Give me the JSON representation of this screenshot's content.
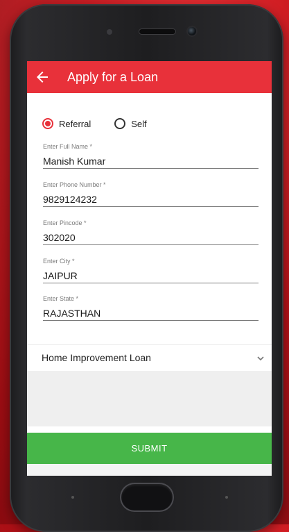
{
  "app_bar": {
    "title": "Apply for a Loan"
  },
  "applicant_type": {
    "options": [
      {
        "label": "Referral",
        "selected": true
      },
      {
        "label": "Self",
        "selected": false
      }
    ]
  },
  "fields": [
    {
      "label": "Enter Full Name *",
      "value": "Manish Kumar"
    },
    {
      "label": "Enter Phone Number *",
      "value": "9829124232"
    },
    {
      "label": "Enter Pincode *",
      "value": "302020"
    },
    {
      "label": "Enter City *",
      "value": "JAIPUR"
    },
    {
      "label": "Enter State *",
      "value": "RAJASTHAN"
    }
  ],
  "loan_type": {
    "selected": "Home Improvement Loan"
  },
  "submit_label": "SUBMIT",
  "colors": {
    "accent": "#e8313a",
    "submit": "#47b649",
    "background": "#c8141b"
  },
  "icons": {
    "back": "arrow-left-icon",
    "dropdown": "chevron-down-icon"
  }
}
